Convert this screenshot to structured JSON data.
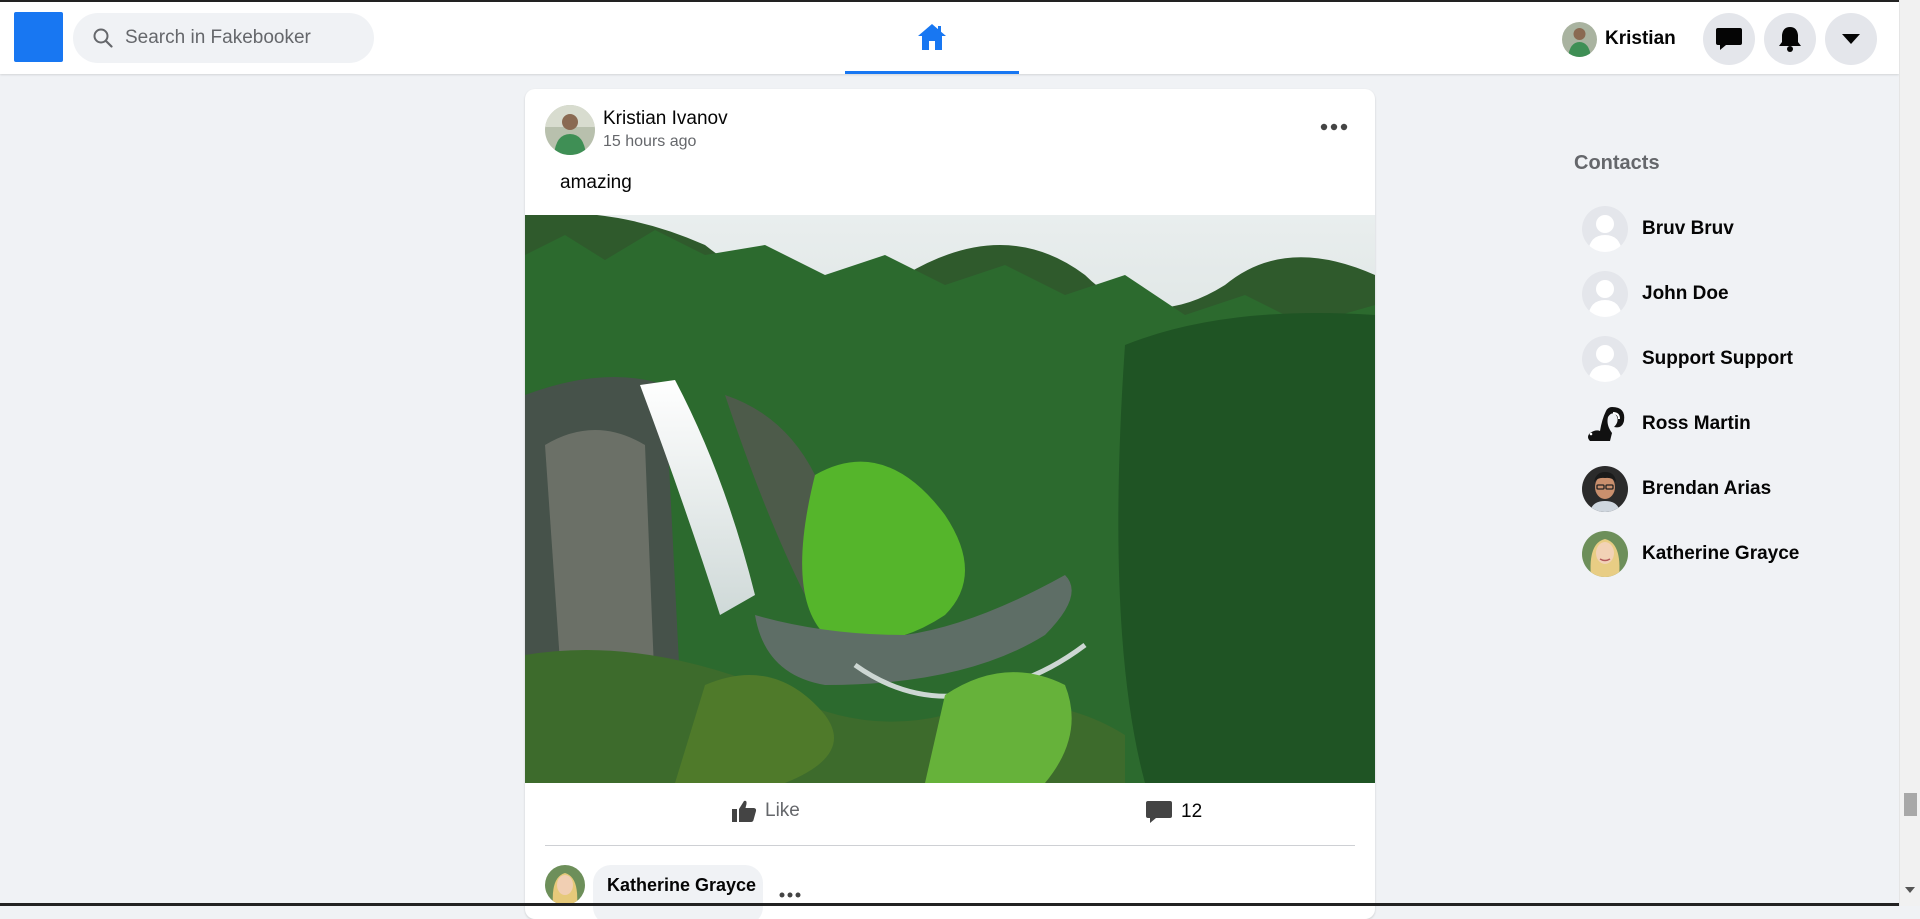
{
  "header": {
    "search_placeholder": "Search in Fakebooker",
    "profile_name": "Kristian",
    "icons": [
      "logo-icon",
      "search-icon",
      "home-icon",
      "messenger-icon",
      "bell-icon",
      "caret-down-icon"
    ],
    "accent_color": "#1877f2"
  },
  "post": {
    "author": "Kristian Ivanov",
    "time": "15 hours ago",
    "text": "amazing",
    "like_label": "Like",
    "comment_count": "12",
    "comment_preview": {
      "author": "Katherine Grayce"
    }
  },
  "contacts": {
    "title": "Contacts",
    "items": [
      {
        "name": "Bruv Bruv",
        "avatar": "default-avatar"
      },
      {
        "name": "John Doe",
        "avatar": "default-avatar"
      },
      {
        "name": "Support Support",
        "avatar": "default-avatar"
      },
      {
        "name": "Ross Martin",
        "avatar": "skunk-avatar"
      },
      {
        "name": "Brendan Arias",
        "avatar": "man-photo-avatar"
      },
      {
        "name": "Katherine Grayce",
        "avatar": "woman-photo-avatar"
      }
    ]
  }
}
